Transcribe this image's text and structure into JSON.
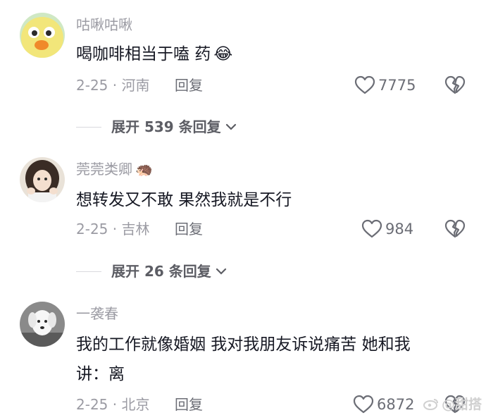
{
  "comments": [
    {
      "username": "咕啾咕啾",
      "text": "喝咖啡相当于嗑 药",
      "emoji": "😂",
      "date_location": "2-25 · 河南",
      "reply_label": "回复",
      "likes": "7775"
    },
    {
      "username": "莞莞类卿",
      "username_emoji": "🦔",
      "text": "想转发又不敢 果然我就是不行",
      "date_location": "2-25 · 吉林",
      "reply_label": "回复",
      "likes": "984"
    },
    {
      "username": "一袭春",
      "text_line1": "我的工作就像婚姻 我对我朋友诉说痛苦 她和我",
      "text_line2": "讲：离",
      "date_location": "2-25 · 北京",
      "reply_label": "回复",
      "likes": "6872"
    }
  ],
  "expanders": [
    {
      "label": "展开 539 条回复"
    },
    {
      "label": "展开 26 条回复"
    }
  ],
  "watermark": "@甜搭",
  "colors": {
    "text_primary": "#161823",
    "text_secondary": "#9b9ba3",
    "action": "#6b6d75",
    "background": "#ffffff"
  }
}
